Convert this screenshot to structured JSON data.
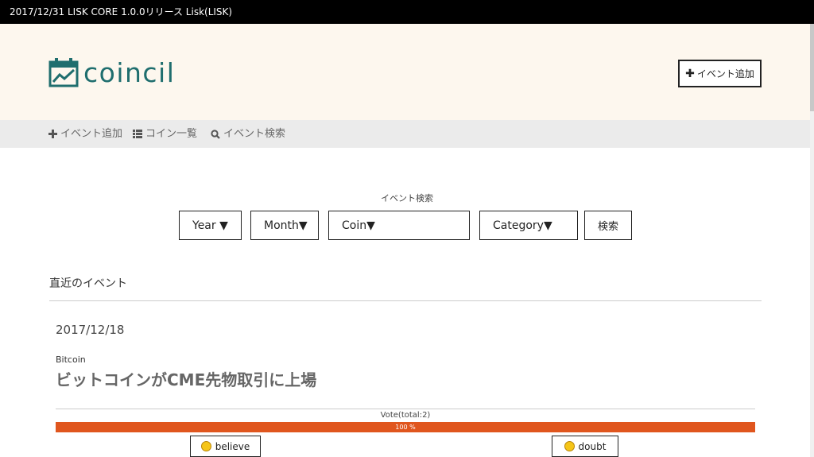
{
  "ticker": {
    "text": "2017/12/31 LISK CORE 1.0.0リリース Lisk(LISK)"
  },
  "header": {
    "logo_text": "coincil",
    "add_event_label": "イベント追加"
  },
  "nav": {
    "items": [
      {
        "icon": "plus-icon",
        "label": "イベント追加"
      },
      {
        "icon": "list-icon",
        "label": "コイン一覧"
      },
      {
        "icon": "search-icon",
        "label": "イベント検索"
      }
    ]
  },
  "search": {
    "title": "イベント検索",
    "year": "Year ▼",
    "month": "Month▼",
    "coin": "Coin▼",
    "category": "Category▼",
    "submit": "検索"
  },
  "recent": {
    "title": "直近のイベント",
    "event": {
      "date": "2017/12/18",
      "coin": "Bitcoin",
      "title": "ビットコインがCME先物取引に上場",
      "vote_total": "Vote(total:2)",
      "believe_fraction": 1.0,
      "percent_label": "100 %",
      "believe_label": "believe",
      "doubt_label": "doubt"
    }
  },
  "colors": {
    "ticker_bg": "#000000",
    "header_bg": "#fdf7ee",
    "nav_bg": "#ebebeb",
    "brand": "#1f6e6e",
    "vote_bar": "#e0561e"
  }
}
